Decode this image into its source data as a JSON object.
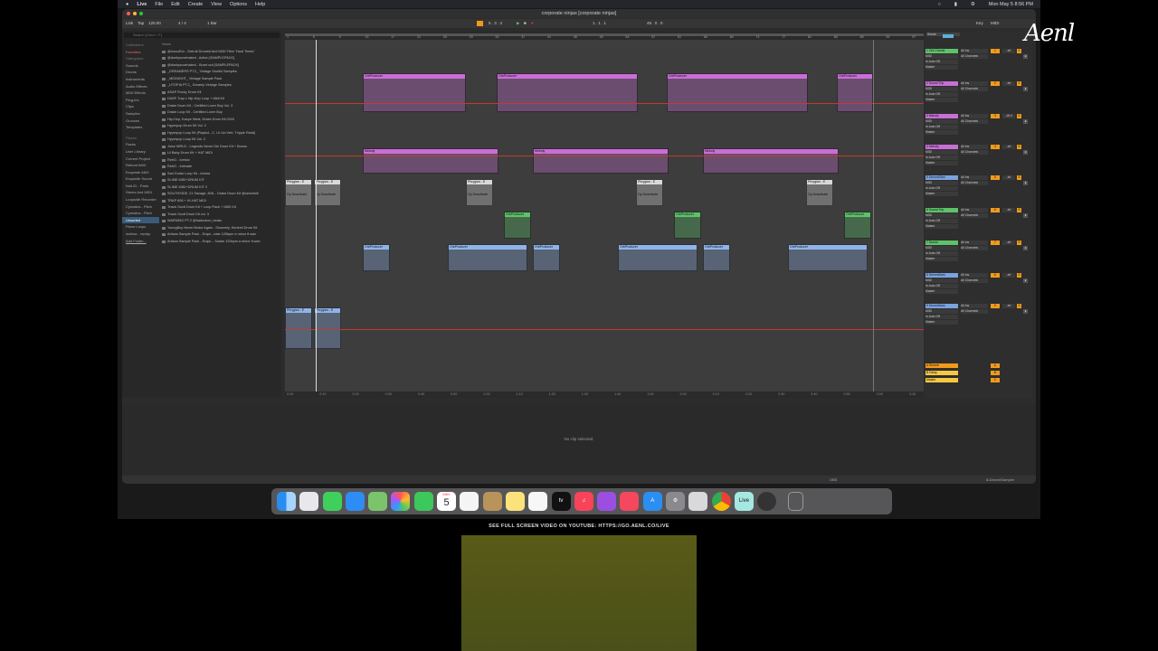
{
  "menubar": {
    "apple": "",
    "app": "Live",
    "items": [
      "File",
      "Edit",
      "Create",
      "View",
      "Options",
      "Help"
    ],
    "clock": "Mon May 5  8:56 PM"
  },
  "window": {
    "title": "corporate ninjas  [corporate ninjas]"
  },
  "controlbar": {
    "link": "Link",
    "tap": "Tap",
    "tempo": "120.00",
    "signature": "4 / 4",
    "quantize": "1 Bar",
    "position": "5 . 3 . 4",
    "loop_start": "1 . 1 . 1",
    "loop_len": "48 . 0 . 0",
    "key": "Key",
    "midi": "MIDI"
  },
  "browser": {
    "search_placeholder": "Search (Cmd + F)",
    "collections_header": "Collections",
    "categories_header": "Categories",
    "places_header": "Places",
    "favorites": "Favorites",
    "categories": [
      "Sounds",
      "Drums",
      "Instruments",
      "Audio Effects",
      "MIDI Effects",
      "Plug-ins",
      "Clips",
      "Samples",
      "Grooves",
      "Templates"
    ],
    "places": [
      "Packs",
      "User Library",
      "Current Project",
      "Reboot AMX",
      "Exquisite AMX",
      "Exquisite Sound",
      "Noti.ID - Parts",
      "Stems And MIDI",
      "Loopside Recorder",
      "Cymatics - Pitch",
      "Cymatics - Pitch",
      "Unsorted",
      "Piano Loops",
      "mellow - replay",
      "Add Folder..."
    ],
    "name_header": "Name",
    "files": [
      "@moozfl1x - Detroit Drumkit And MIDI Files \"Hard Times\"",
      "@dontyouvehaked - Action [SAMPLEPACK]",
      "@dontyouvehaked - Burnt out [SAMPLEPACK]",
      "_DREAMERS PT.2_ Vintage Soulful Samples",
      "_MIDNIGHT_ Vintage Sample Pack",
      "_UTOPIA PT.2_ Dreamy Vintage Samples",
      "ASAP Rocky Drum Kit",
      "DAVE Trap x Hip-Hop Loop + Midi Kit",
      "Drake Drum Kit - Certified Lover Boy Vol. 3",
      "Drake Loop Kit - Certified Lover Boy",
      "Hip-Hop, Kanye West, Drake Drum Kit 2020",
      "Hyperpop Drum Kit Vol. 2",
      "Hyperpop Loop Kit (Playboi...C, Lil Uzi Vert, Trippie Redd)",
      "Hyperpop Loop Kit Vol. 2",
      "Juice WRLD - Legends Never Die Drum Kit + Bonus",
      "Lil Baby Drum Kit + HAT MIDI",
      "RetrO - Icebox",
      "RetrO - Intimate",
      "Sad Guitar Loop Kit - Anima",
      "SLIME MIDI+DRUM KIT",
      "SLIME MIDI+DRUM KIT 2",
      "SOUTHSIDE, 21 Savage, 808... Drake Drum Kit @selomkill",
      "TRAP 808 + HI-HAT MIDI",
      "Travis Scott Drum Kit + Loop Pack + MIDI Kit",
      "Travis Scott Drum Kit vol. 3",
      "WARNING PT.2 @hadoukon_beats",
      "YoungBoy Never Broke Again - Sincerely, Kentrell Drum Kit",
      "Artisan Sample Pack - Exqui...nate 120bpm e minor ft.wav",
      "Artisan Sample Pack - Exqui... Snake 120bpm a minor ft.wav"
    ]
  },
  "arrangement": {
    "bar_numbers": [
      "1",
      "5",
      "9",
      "13",
      "17",
      "21",
      "25",
      "29",
      "33",
      "37",
      "41",
      "45",
      "49",
      "53",
      "57",
      "61",
      "65",
      "69",
      "73",
      "77",
      "81",
      "85",
      "89",
      "93",
      "97"
    ],
    "time_labels": [
      "0:00",
      "0:10",
      "0:20",
      "0:30",
      "0:40",
      "0:50",
      "1:00",
      "1:10",
      "1:20",
      "1:30",
      "1:40",
      "1:50",
      "2:00",
      "2:10",
      "2:20",
      "2:30",
      "2:40",
      "2:50",
      "3:00",
      "3:10"
    ],
    "clip_labels": {
      "orb": "OrbProducer",
      "melody": "Melody",
      "phrygian": "Phrygian - E",
      "deactivate": "Op Deactivate"
    }
  },
  "mixer": {
    "tracks": [
      {
        "name": "1 Orb Chords",
        "color": "#5ec26a",
        "num": "1",
        "vol": "-inf",
        "input": "All Ins",
        "channel": "All Channels",
        "monitor": "In  Auto  Off",
        "output": "Master"
      },
      {
        "name": "2 Sound Trip",
        "color": "#c86fd6",
        "num": "2",
        "vol": "-inf",
        "input": "All Ins",
        "channel": "All Channels",
        "monitor": "In  Auto  Off",
        "output": "Master"
      },
      {
        "name": "3 Melody",
        "color": "#c86fd6",
        "num": "3",
        "vol": "-18.0",
        "input": "All Ins",
        "channel": "All Channels",
        "monitor": "In  Auto  Off",
        "output": "Master"
      },
      {
        "name": "4 Melody",
        "color": "#c86fd6",
        "num": "4",
        "vol": "-inf",
        "input": "All Ins",
        "channel": "All Channels",
        "monitor": "In  Auto  Off",
        "output": "Master"
      },
      {
        "name": "5 DecentSam",
        "color": "#7aa3e0",
        "num": "5",
        "vol": "-inf",
        "input": "All Ins",
        "channel": "All Channels",
        "monitor": "In  Auto  Off",
        "output": "Master"
      },
      {
        "name": "6 Sound Trip",
        "color": "#5ec26a",
        "num": "6",
        "vol": "-inf",
        "input": "All Ins",
        "channel": "All Channels",
        "monitor": "In  Auto  Off",
        "output": "Master"
      },
      {
        "name": "7 Drums",
        "color": "#5ec26a",
        "num": "7",
        "vol": "-inf",
        "input": "All Ins",
        "channel": "All Channels",
        "monitor": "In  Auto  Off",
        "output": "Master"
      },
      {
        "name": "8 DecentSam",
        "color": "#7aa3e0",
        "num": "8",
        "vol": "-inf",
        "input": "All Ins",
        "channel": "All Channels",
        "monitor": "In  Auto  Off",
        "output": "Master"
      },
      {
        "name": "9 DecentSam",
        "color": "#7aa3e0",
        "num": "9",
        "vol": "-inf",
        "input": "All Ins",
        "channel": "All Channels",
        "monitor": "In  Auto  Off",
        "output": "Master"
      }
    ],
    "returns": [
      {
        "name": "A Reverb",
        "color": "#f19a1c"
      },
      {
        "name": "B Delay",
        "color": "#f5c842"
      },
      {
        "name": "Master",
        "color": "#f5c842"
      }
    ],
    "sends_label": "Sends",
    "master_vol": "0",
    "master_ratio": "1/2"
  },
  "detail": {
    "message": "No clip selected."
  },
  "status": {
    "obs": "OBS",
    "device": "8-DecentSampler"
  },
  "dock": {
    "calendar_month": "MAY",
    "calendar_day": "5",
    "live_label": "Live"
  },
  "caption": "SEE FULL SCREEN VIDEO ON YOUTUBE: HTTPS://GO.AENL.CO/LIVE",
  "logo": "Aenl"
}
